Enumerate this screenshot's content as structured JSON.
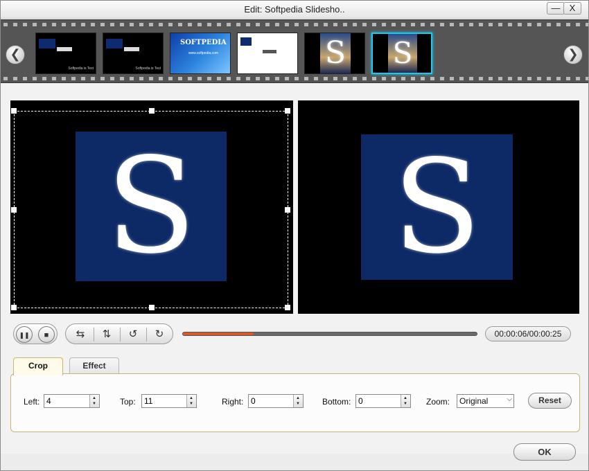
{
  "window": {
    "title": "Edit: Softpedia Slidesho..",
    "minimize_label": "—",
    "close_label": "X"
  },
  "filmstrip": {
    "prev_label": "❮",
    "next_label": "❯",
    "thumbs": [
      {
        "caption": "Softpedia is Test"
      },
      {
        "caption": "Softpedia is Test"
      },
      {
        "brand": "SOFTPEDIA",
        "url": "www.softpedia.com"
      },
      {
        "caption": ""
      },
      {
        "caption": ""
      },
      {
        "caption": ""
      }
    ]
  },
  "preview": {
    "logo_letter": "S"
  },
  "player": {
    "progress": 0.24,
    "time": "00:00:06/00:00:25",
    "pause_icon": "❚❚",
    "stop_icon": "■",
    "flip_h_icon": "⇆",
    "flip_v_icon": "⇅",
    "rotate_ccw_icon": "↺",
    "rotate_cw_icon": "↻"
  },
  "tabs": {
    "crop": "Crop",
    "effect": "Effect"
  },
  "crop": {
    "left_label": "Left:",
    "left_value": "4",
    "top_label": "Top:",
    "top_value": "11",
    "right_label": "Right:",
    "right_value": "0",
    "bottom_label": "Bottom:",
    "bottom_value": "0",
    "zoom_label": "Zoom:",
    "zoom_value": "Original",
    "reset_label": "Reset"
  },
  "footer": {
    "ok_label": "OK"
  }
}
